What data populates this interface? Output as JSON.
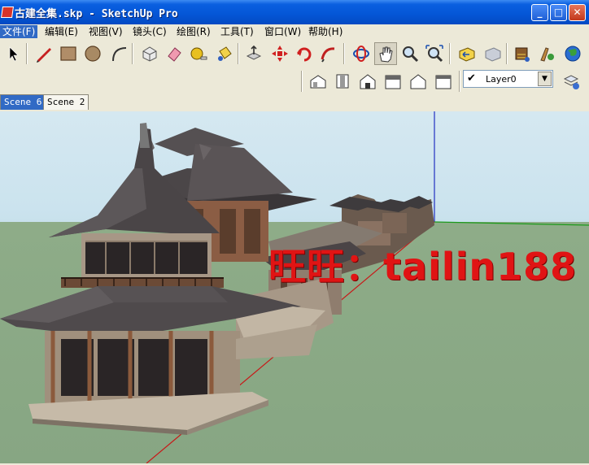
{
  "window": {
    "title": "古建全集.skp - SketchUp Pro",
    "minimize": "_",
    "maximize": "□",
    "close": "✕"
  },
  "menu": [
    "文件(F)",
    "编辑(E)",
    "视图(V)",
    "镜头(C)",
    "绘图(R)",
    "工具(T)",
    "窗口(W)",
    "帮助(H)"
  ],
  "toolbar": {
    "tools": [
      "select-icon",
      "pencil-icon",
      "rectangle-icon",
      "circle-icon",
      "arc-icon",
      "make-component-icon",
      "eraser-icon",
      "tape-measure-icon",
      "paint-bucket-icon",
      "push-pull-icon",
      "move-icon",
      "rotate-icon",
      "follow-me-icon",
      "orbit-icon",
      "pan-icon",
      "zoom-icon",
      "zoom-extents-icon",
      "previous-view-icon",
      "next-view-icon",
      "warehouse-icon",
      "components-icon",
      "google-earth-icon"
    ],
    "views": [
      "iso-view-icon",
      "top-view-icon",
      "front-view-icon",
      "right-view-icon",
      "back-view-icon",
      "left-view-icon"
    ]
  },
  "layer": {
    "current": "Layer0",
    "visible_check": "✔",
    "dropdown_arrow": "▼"
  },
  "scenes": [
    "Scene 6",
    "Scene 2"
  ],
  "active_scene": "Scene 6",
  "watermark": "旺旺：tailin188",
  "colors": {
    "titlebar": "#0456d6",
    "selection": "#316ac5",
    "sky": "#cbe3ee",
    "ground": "#8eac88",
    "watermark": "#e01414"
  }
}
